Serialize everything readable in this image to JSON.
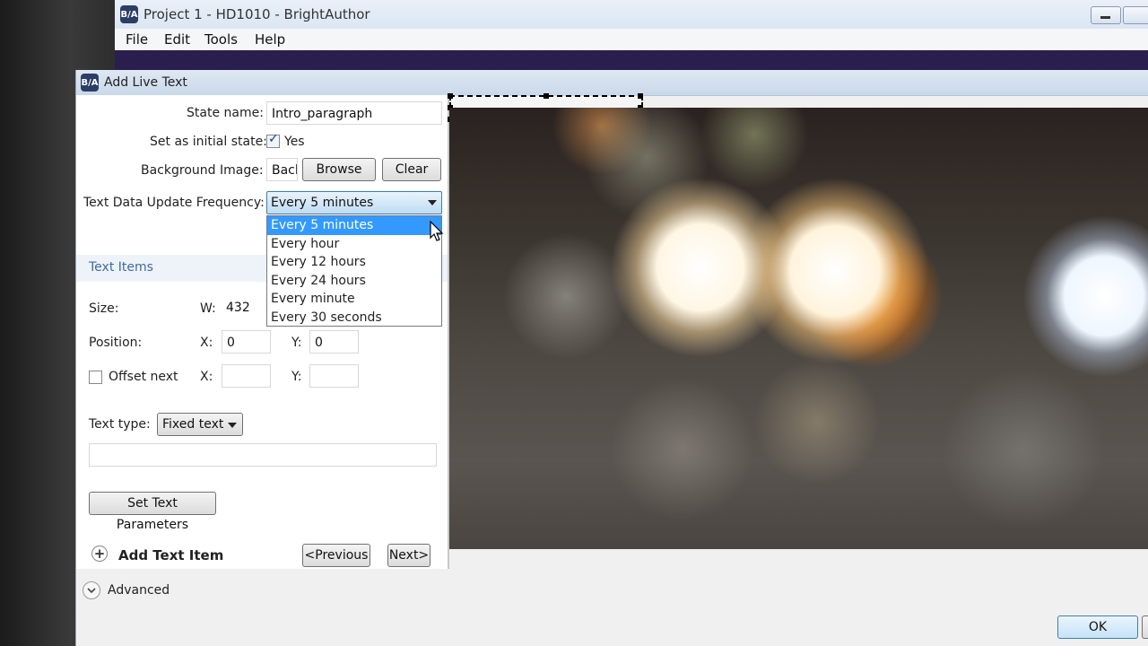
{
  "main_window": {
    "logo": "B/A",
    "title": "Project 1 - HD1010 - BrightAuthor",
    "menu": [
      "File",
      "Edit",
      "Tools",
      "Help"
    ]
  },
  "dialog": {
    "logo": "B/A",
    "title": "Add Live Text",
    "state_name": {
      "label": "State name:",
      "value": "Intro_paragraph"
    },
    "initial_state": {
      "label": "Set as initial state:",
      "checked": true,
      "option": "Yes"
    },
    "background_image": {
      "label": "Background Image:",
      "value": "Bacl",
      "browse": "Browse",
      "clear": "Clear"
    },
    "update_frequency": {
      "label": "Text Data Update Frequency:",
      "selected": "Every 5 minutes",
      "options": [
        "Every 5 minutes",
        "Every hour",
        "Every 12 hours",
        "Every 24 hours",
        "Every minute",
        "Every 30 seconds"
      ]
    },
    "text_items_header": "Text Items",
    "size": {
      "label": "Size:",
      "w_label": "W:",
      "w_value": "432"
    },
    "position": {
      "label": "Position:",
      "x_label": "X:",
      "x_value": "0",
      "y_label": "Y:",
      "y_value": "0"
    },
    "offset_next": {
      "label": "Offset next",
      "checked": false,
      "x_label": "X:",
      "x_value": "",
      "y_label": "Y:",
      "y_value": ""
    },
    "text_type": {
      "label": "Text type:",
      "value": "Fixed text"
    },
    "set_text_params": "Set Text Parameters",
    "add_text_item": "Add Text Item",
    "previous": "<Previous",
    "next": "Next>",
    "advanced": "Advanced",
    "ok": "OK"
  },
  "icons": [
    "app-logo-icon",
    "minimize-icon",
    "maximize-icon",
    "checkbox-icon",
    "dropdown-arrow-icon",
    "mouse-cursor-icon",
    "plus-circle-icon",
    "chevron-down-circle-icon"
  ]
}
